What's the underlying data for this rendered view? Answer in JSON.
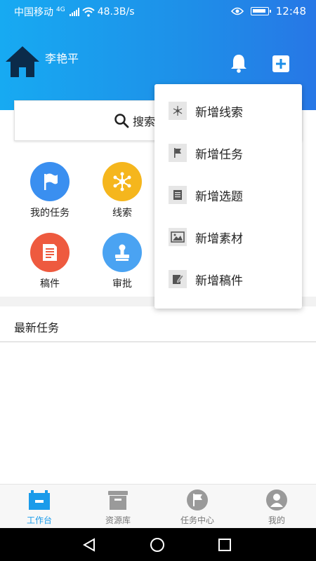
{
  "status_bar": {
    "carrier": "中国移动",
    "network": "4G",
    "speed": "48.3B/s",
    "time": "12:48"
  },
  "header": {
    "username": "李艳平",
    "icons": [
      "home-icon",
      "bell-icon",
      "plus-icon"
    ]
  },
  "search": {
    "label": "搜索"
  },
  "grid": {
    "items": [
      {
        "label": "我的任务",
        "icon": "flag-icon",
        "color": "#3a8ff0"
      },
      {
        "label": "线索",
        "icon": "network-icon",
        "color": "#f5b61d"
      },
      {
        "label": "稿件",
        "icon": "document-icon",
        "color": "#ee5a3f"
      },
      {
        "label": "审批",
        "icon": "stamp-icon",
        "color": "#4aa3f2"
      }
    ]
  },
  "latest": {
    "title": "最新任务"
  },
  "dropdown": {
    "items": [
      {
        "label": "新增线索",
        "icon": "network-icon"
      },
      {
        "label": "新增任务",
        "icon": "flag-icon"
      },
      {
        "label": "新增选题",
        "icon": "list-icon"
      },
      {
        "label": "新增素材",
        "icon": "image-icon"
      },
      {
        "label": "新增稿件",
        "icon": "edit-icon"
      }
    ]
  },
  "tabbar": {
    "active_color": "#1a9bea",
    "tabs": [
      {
        "label": "工作台",
        "icon": "workbench-icon",
        "active": true
      },
      {
        "label": "资源库",
        "icon": "archive-icon",
        "active": false
      },
      {
        "label": "任务中心",
        "icon": "flag-icon",
        "active": false
      },
      {
        "label": "我的",
        "icon": "person-icon",
        "active": false
      }
    ]
  },
  "nav": {
    "icons": [
      "back-icon",
      "home-circle-icon",
      "recents-icon"
    ]
  }
}
